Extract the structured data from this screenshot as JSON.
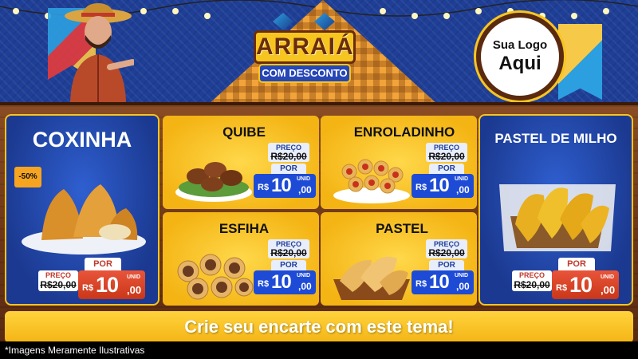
{
  "header": {
    "logo_line1": "ARRAIÁ",
    "logo_line2": "COM DESCONTO",
    "your_logo_line1": "Sua Logo",
    "your_logo_line2": "Aqui"
  },
  "colors": {
    "header_blue": "#1f3f97",
    "card_yellow": "#f4b414",
    "price_blue": "#1e4bd6",
    "price_orange": "#c93618",
    "wood": "#6b3517"
  },
  "side_products": {
    "left": {
      "name": "COXINHA",
      "discount_badge": "-50%",
      "por_label": "POR",
      "preco_label": "PREÇO",
      "old_price": "R$20,00",
      "currency": "R$",
      "price_int": "10",
      "price_cents": ",00",
      "unit": "UNID"
    },
    "right": {
      "name": "PASTEL DE MILHO",
      "por_label": "POR",
      "preco_label": "PREÇO",
      "old_price": "R$20,00",
      "currency": "R$",
      "price_int": "10",
      "price_cents": ",00",
      "unit": "UNID"
    }
  },
  "mid_products": [
    {
      "name": "QUIBE",
      "preco_label": "PREÇO",
      "old_price": "R$20,00",
      "por_label": "POR",
      "currency": "R$",
      "price_int": "10",
      "price_cents": ",00",
      "unit": "UNID",
      "icon": "kibbeh-icon"
    },
    {
      "name": "ENROLADINHO",
      "preco_label": "PREÇO",
      "old_price": "R$20,00",
      "por_label": "POR",
      "currency": "R$",
      "price_int": "10",
      "price_cents": ",00",
      "unit": "UNID",
      "icon": "sausage-roll-icon"
    },
    {
      "name": "ESFIHA",
      "preco_label": "PREÇO",
      "old_price": "R$20,00",
      "por_label": "POR",
      "currency": "R$",
      "price_int": "10",
      "price_cents": ",00",
      "unit": "UNID",
      "icon": "esfiha-icon"
    },
    {
      "name": "PASTEL",
      "preco_label": "PREÇO",
      "old_price": "R$20,00",
      "por_label": "POR",
      "currency": "R$",
      "price_int": "10",
      "price_cents": ",00",
      "unit": "UNID",
      "icon": "pastel-icon"
    }
  ],
  "banner_text": "Crie seu encarte com este tema!",
  "footnote": "*Imagens Meramente Ilustrativas"
}
